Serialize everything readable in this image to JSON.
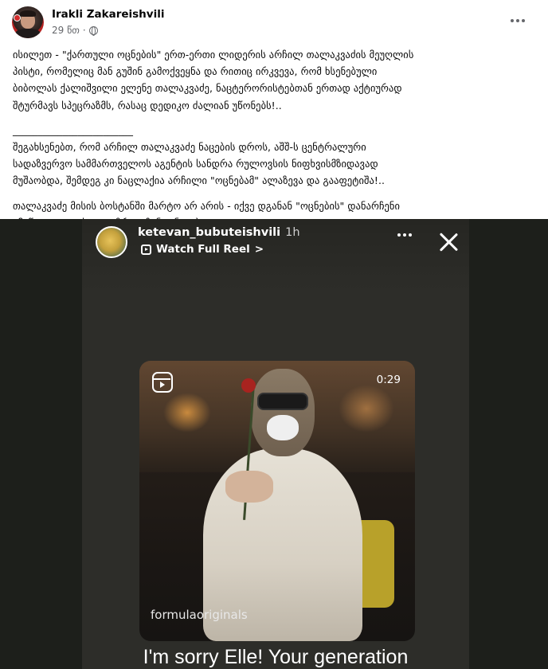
{
  "post": {
    "author": "Irakli Zakareishvili",
    "time": "29 წთ",
    "meta_separator": "·",
    "paragraph1": [
      "ისილეთ - \"ქართული ოცნების\" ერთ-ერთი ლიდერის არჩილ თალაკვაძის მეუღლის",
      "პისტი, რომელიც მან გუშინ გამოქვეყნა და რითიც ირკვევა, რომ ხსენებული",
      "ბიბოლას ქალიშვილი ელენე თალაკვაძე, ნაცტერორისტებთან ერთად აქტიურად",
      "შტურმავს სპეცრაზმს, რასაც დედიკო ძალიან უწონებს!.."
    ],
    "divider": "________________________",
    "paragraph2": [
      "შეგახსენებთ, რომ არჩილ თალაკვაძე ნაცების დროს, აშშ-ს ცენტრალური",
      "სადაზვერვო სამმართველოს აგენტის სანდრა რულოვსის ნიფხვისმზიდავად",
      "მუშაობდა, შემდეგ კი ნაცლაქია არჩილი \"ოცნებამ\" ალაზევა და გააფეტიშა!.."
    ],
    "paragraph3": [
      "თალაკვაძე მისის ბოსტანში მარტო არ არის - იქვე დგანან \"ოცნების\" დანარჩენი",
      "ყმაწვილი თუ ძველგაზრდა ჩინოვნიკებიც!.."
    ]
  },
  "story": {
    "username": "ketevan_bubuteishvili",
    "time": "1h",
    "watch_label": "Watch Full Reel",
    "watch_chevron": ">",
    "reel_duration": "0:29",
    "reel_source": "formulaoriginals",
    "caption": "I'm sorry Elle! Your generation"
  },
  "icons": {
    "visibility": "globe-icon",
    "more": "more-horizontal-icon",
    "close": "close-icon",
    "reel": "reels-icon"
  },
  "colors": {
    "secondary_text": "#65676b",
    "media_background": "#1d1f1b",
    "story_text": "#ffffff"
  }
}
